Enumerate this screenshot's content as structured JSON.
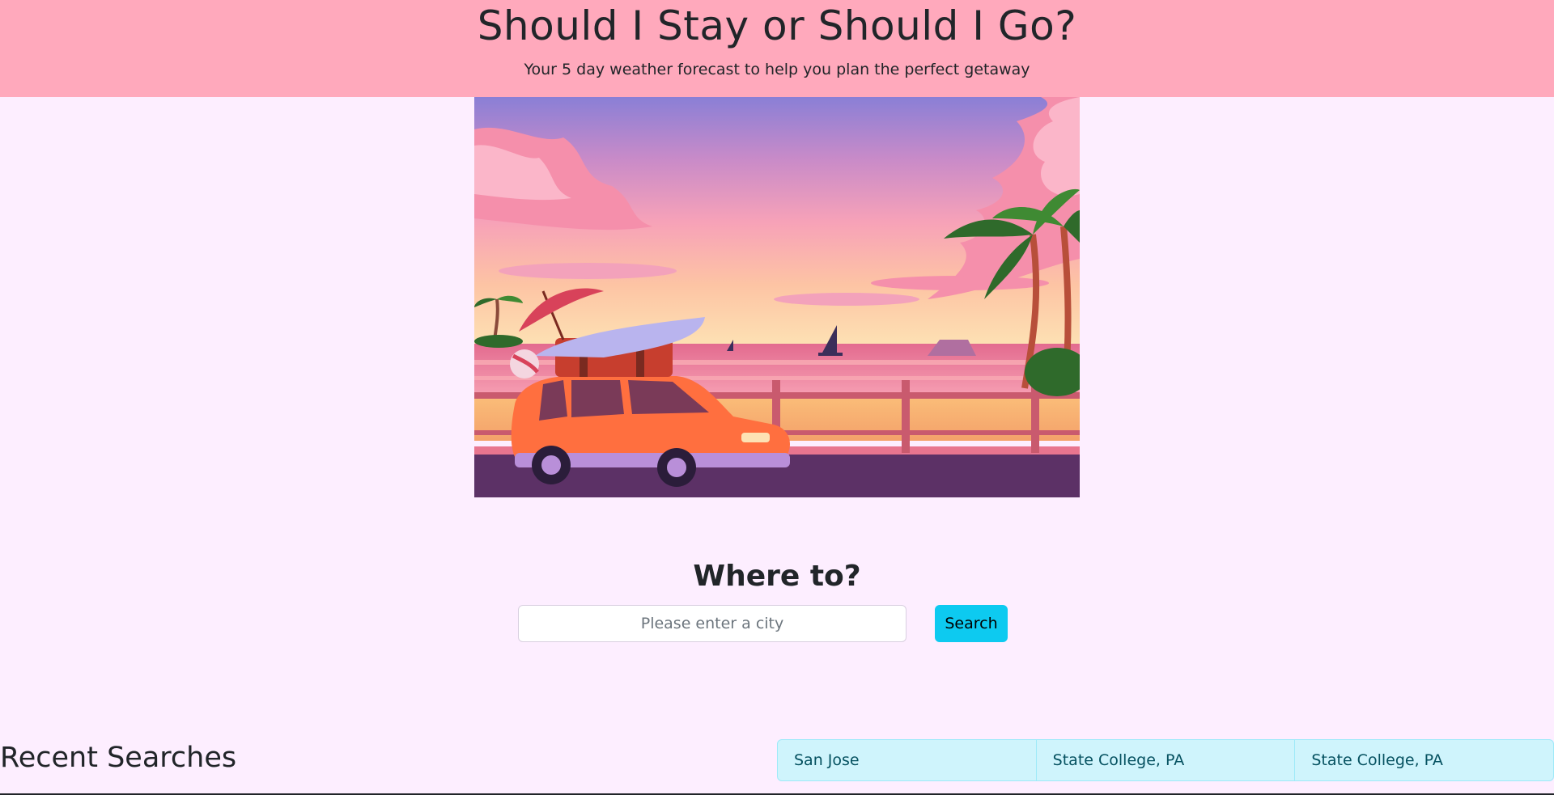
{
  "header": {
    "title": "Should I Stay or Should I Go?",
    "subtitle": "Your 5 day weather forecast to help you plan the perfect getaway",
    "background_color": "#ffa9bc"
  },
  "hero": {
    "image_name": "beach-roadtrip-illustration"
  },
  "search": {
    "heading": "Where to?",
    "placeholder": "Please enter a city",
    "value": "",
    "button_label": "Search",
    "button_color": "#0dcaf0"
  },
  "recent": {
    "heading": "Recent Searches",
    "items": [
      {
        "label": "San Jose"
      },
      {
        "label": "State College, PA"
      },
      {
        "label": "State College, PA"
      }
    ],
    "item_background": "#cff4fc"
  },
  "page": {
    "background_color": "#fdeeff"
  }
}
